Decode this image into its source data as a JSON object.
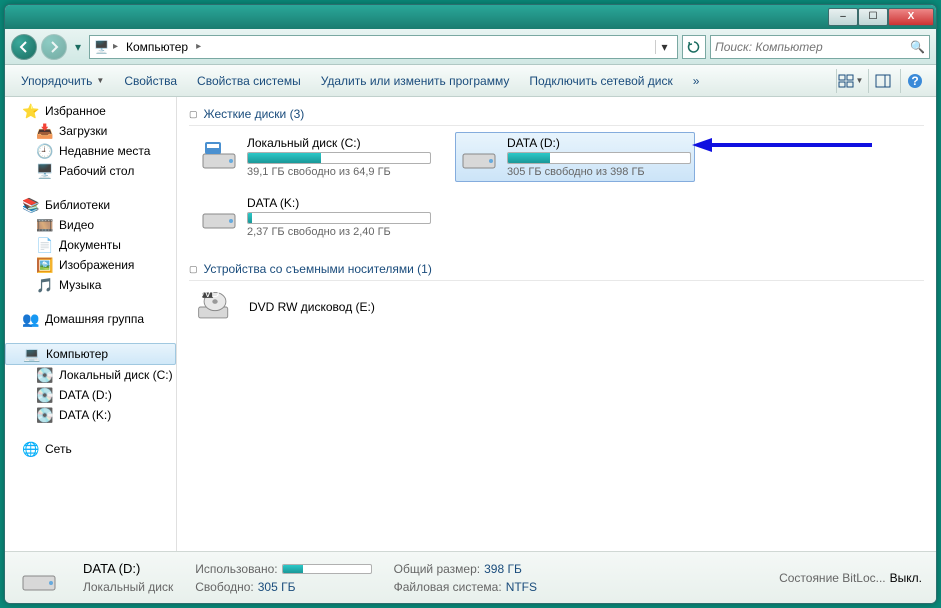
{
  "window_controls": {
    "min": "–",
    "max": "☐",
    "close": "X"
  },
  "nav": {
    "breadcrumb_root": "Компьютер",
    "search_placeholder": "Поиск: Компьютер"
  },
  "toolbar": {
    "organize": "Упорядочить",
    "properties": "Свойства",
    "system_properties": "Свойства системы",
    "uninstall": "Удалить или изменить программу",
    "map_drive": "Подключить сетевой диск",
    "more": "»"
  },
  "sidebar": {
    "favorites": {
      "label": "Избранное",
      "items": [
        "Загрузки",
        "Недавние места",
        "Рабочий стол"
      ]
    },
    "libraries": {
      "label": "Библиотеки",
      "items": [
        "Видео",
        "Документы",
        "Изображения",
        "Музыка"
      ]
    },
    "homegroup": {
      "label": "Домашняя группа"
    },
    "computer": {
      "label": "Компьютер",
      "items": [
        "Локальный диск (C:)",
        "DATA (D:)",
        "DATA (K:)"
      ]
    },
    "network": {
      "label": "Сеть"
    }
  },
  "sections": {
    "hdd": {
      "title": "Жесткие диски (3)"
    },
    "removable": {
      "title": "Устройства со съемными носителями (1)"
    }
  },
  "drives": {
    "c": {
      "name": "Локальный диск (C:)",
      "free": "39,1 ГБ свободно из 64,9 ГБ",
      "fill_pct": 40
    },
    "d": {
      "name": "DATA (D:)",
      "free": "305 ГБ свободно из 398 ГБ",
      "fill_pct": 23
    },
    "k": {
      "name": "DATA (K:)",
      "free": "2,37 ГБ свободно из 2,40 ГБ",
      "fill_pct": 2
    }
  },
  "removable": {
    "dvd": {
      "name": "DVD RW дисковод (E:)"
    }
  },
  "details": {
    "name": "DATA (D:)",
    "type": "Локальный диск",
    "used_label": "Использовано:",
    "free_label": "Свободно:",
    "free_val": "305 ГБ",
    "total_label": "Общий размер:",
    "total_val": "398 ГБ",
    "fs_label": "Файловая система:",
    "fs_val": "NTFS",
    "bitlocker_label": "Состояние BitLoc...",
    "bitlocker_val": "Выкл.",
    "fill_pct": 23
  }
}
